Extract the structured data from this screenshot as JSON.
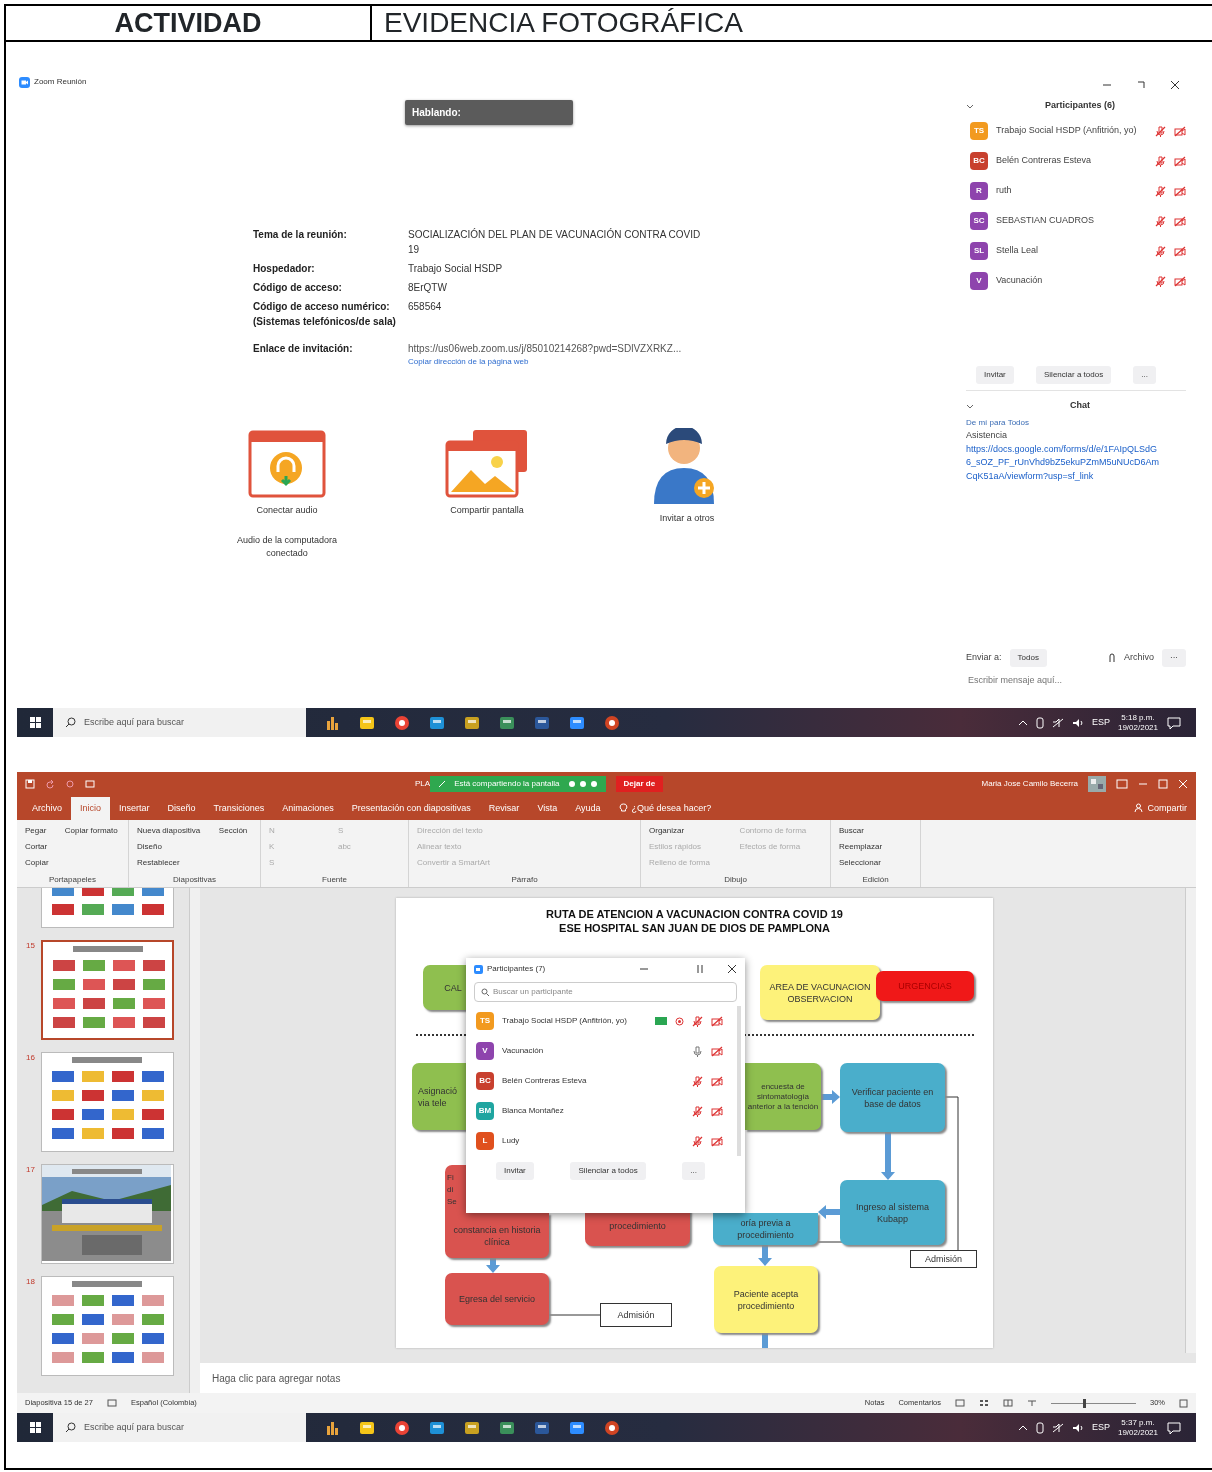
{
  "header": {
    "activity": "ACTIVIDAD",
    "evidence": "EVIDENCIA FOTOGRÁFICA"
  },
  "zoom": {
    "title": "Zoom Reunión",
    "speaking": "Hablando:",
    "info": [
      {
        "label": "Tema de la reunión:",
        "value": "SOCIALIZACIÓN DEL PLAN DE VACUNACIÓN CONTRA COVID 19"
      },
      {
        "label": "Hospedador:",
        "value": "Trabajo Social HSDP"
      },
      {
        "label": "Código de acceso:",
        "value": "8ErQTW"
      },
      {
        "label": "Código de acceso numérico: (Sistemas telefónicos/de sala)",
        "value": "658564"
      }
    ],
    "invite": {
      "label": "Enlace de invitación:",
      "url": "https://us06web.zoom.us/j/85010214268?pwd=SDlVZXRKZ...",
      "copy": "Copiar dirección de la página web"
    },
    "actions": [
      {
        "kind": "audio",
        "label": "Conectar audio",
        "note": "Audio de la computadora conectado"
      },
      {
        "kind": "share",
        "label": "Compartir pantalla"
      },
      {
        "kind": "invite",
        "label": "Invitar a otros"
      }
    ],
    "participants_title": "Participantes (6)",
    "participants": [
      {
        "initials": "TS",
        "name": "Trabajo Social HSDP (Anfitrión, yo)",
        "color": "#f29a1f",
        "mic_muted": true
      },
      {
        "initials": "BC",
        "name": "Belén Contreras Esteva",
        "color": "#c8402e",
        "mic_muted": true
      },
      {
        "initials": "R",
        "name": "ruth",
        "color": "#8e44ad",
        "mic_muted": true
      },
      {
        "initials": "SC",
        "name": "SEBASTIAN CUADROS",
        "color": "#8e44ad",
        "mic_muted": true
      },
      {
        "initials": "SL",
        "name": "Stella Leal",
        "color": "#8e44ad",
        "mic_muted": true
      },
      {
        "initials": "V",
        "name": "Vacunación",
        "color": "#8e44ad",
        "mic_muted": true
      }
    ],
    "buttons": [
      "Invitar",
      "Silenciar a todos",
      "..."
    ],
    "chat": {
      "title": "Chat",
      "from": "De mí para Todos",
      "message": "Asistencia",
      "link": "https://docs.google.com/forms/d/e/1FAIpQLSdG6_sOZ_PF_rUnVhd9bZ5ekuPZmM5uNUcD6AmCqK51aA/viewform?usp=sf_link"
    },
    "send_to_label": "Enviar a:",
    "send_to": "Todos",
    "file": "Archivo",
    "more": "···",
    "input_placeholder": "Escribir mensaje aquí...",
    "taskbar": {
      "search_placeholder": "Escribe aquí para buscar",
      "lang": "ESP",
      "time": "5:18 p.m.",
      "date": "19/02/2021"
    }
  },
  "powerpoint": {
    "file_title": "PLA",
    "share_text": "Está compartiendo la pantalla",
    "stop": "Dejar de",
    "user": "Maria Jose Camilo Becerra",
    "tabs": [
      {
        "label": "Archivo",
        "selected": false
      },
      {
        "label": "Inicio",
        "selected": true
      },
      {
        "label": "Insertar",
        "selected": false
      },
      {
        "label": "Diseño",
        "selected": false
      },
      {
        "label": "Transiciones",
        "selected": false
      },
      {
        "label": "Animaciones",
        "selected": false
      },
      {
        "label": "Presentación con diapositivas",
        "selected": false
      },
      {
        "label": "Revisar",
        "selected": false
      },
      {
        "label": "Vista",
        "selected": false
      },
      {
        "label": "Ayuda",
        "selected": false
      }
    ],
    "tell_me": "¿Qué desea hacer?",
    "share": "Compartir",
    "ribbon": [
      {
        "group": "Portapapeles",
        "items": [
          {
            "label": "Pegar",
            "disabled": false
          },
          {
            "label": "Cortar",
            "disabled": false
          },
          {
            "label": "Copiar",
            "disabled": false
          },
          {
            "label": "Copiar formato",
            "disabled": false
          }
        ]
      },
      {
        "group": "Diapositivas",
        "items": [
          {
            "label": "Nueva diapositiva",
            "disabled": false
          },
          {
            "label": "Diseño",
            "disabled": false
          },
          {
            "label": "Restablecer",
            "disabled": false
          },
          {
            "label": "Sección",
            "disabled": false
          }
        ]
      },
      {
        "group": "Fuente",
        "items": [
          {
            "label": "N",
            "disabled": true
          },
          {
            "label": "K",
            "disabled": true
          },
          {
            "label": "S",
            "disabled": true
          },
          {
            "label": "S",
            "disabled": true
          },
          {
            "label": "abc",
            "disabled": true
          }
        ]
      },
      {
        "group": "Párrafo",
        "items": [
          {
            "label": "Dirección del texto",
            "disabled": true
          },
          {
            "label": "Alinear texto",
            "disabled": true
          },
          {
            "label": "Convertir a SmartArt",
            "disabled": true
          }
        ]
      },
      {
        "group": "Dibujo",
        "items": [
          {
            "label": "Organizar",
            "disabled": false
          },
          {
            "label": "Estilos rápidos",
            "disabled": true
          },
          {
            "label": "Relleno de forma",
            "disabled": true
          },
          {
            "label": "Contorno de forma",
            "disabled": true
          },
          {
            "label": "Efectos de forma",
            "disabled": true
          }
        ]
      },
      {
        "group": "Edición",
        "items": [
          {
            "label": "Buscar",
            "disabled": false
          },
          {
            "label": "Reemplazar",
            "disabled": false
          },
          {
            "label": "Seleccionar",
            "disabled": false
          }
        ]
      }
    ],
    "thumbnails": [
      {
        "kind": "diagram",
        "selected": false
      },
      {
        "number": "15",
        "kind": "diagram",
        "selected": true
      },
      {
        "number": "16",
        "kind": "diagram",
        "selected": false
      },
      {
        "number": "17",
        "kind": "picture",
        "selected": false
      },
      {
        "number": "18",
        "kind": "diagram",
        "selected": false
      }
    ],
    "slide_title": [
      "RUTA DE ATENCION A VACUNACION CONTRA COVID 19",
      "ESE HOSPITAL SAN JUAN DE DIOS DE PAMPLONA"
    ],
    "boxes": [
      {
        "text": "CAL",
        "color": "#8fbf4f"
      },
      {
        "text": "AREA DE VACUNACION OBSERVACION",
        "color": "#fdf27a"
      },
      {
        "text": "URGENCIAS",
        "color": "#f01818"
      },
      {
        "text": "Asignació via tele",
        "color": "#8fbf4f"
      },
      {
        "text": "encuesta de sintomatología anterior a la tención",
        "color": "#8fbf4f"
      },
      {
        "text": "Verificar paciente en base de datos",
        "color": "#4aaecb"
      },
      {
        "text": "Fi di Se",
        "color": "#d9534f"
      },
      {
        "text": "constancia en historia clínica",
        "color": "#d9534f"
      },
      {
        "text": "procedimiento",
        "color": "#d9534f"
      },
      {
        "text": "oría previa a procedimiento",
        "color": "#4aaecb"
      },
      {
        "text": "Ingreso al sistema Kubapp",
        "color": "#4aaecb"
      },
      {
        "text": "Admisión",
        "color": "#ffffff"
      },
      {
        "text": "Egresa del servicio",
        "color": "#d9534f"
      },
      {
        "text": "Admisión",
        "color": "#ffffff"
      },
      {
        "text": "Paciente acepta procedimiento",
        "color": "#fdf27a"
      }
    ],
    "popup": {
      "title": "Participantes (7)",
      "search_placeholder": "Buscar un participante",
      "items": [
        {
          "initials": "TS",
          "name": "Trabajo Social HSDP (Anfitrión, yo)",
          "color": "#f29a1f",
          "mic_muted": true
        },
        {
          "initials": "V",
          "name": "Vacunación",
          "color": "#8e44ad",
          "mic_muted": false
        },
        {
          "initials": "BC",
          "name": "Belén Contreras Esteva",
          "color": "#c8402e",
          "mic_muted": true
        },
        {
          "initials": "BM",
          "name": "Blanca Montañez",
          "color": "#1fa5a0",
          "mic_muted": true
        },
        {
          "initials": "L",
          "name": "Ludy",
          "color": "#e0501e",
          "mic_muted": true
        }
      ],
      "buttons": [
        "Invitar",
        "Silenciar a todos",
        "..."
      ]
    },
    "notes_placeholder": "Haga clic para agregar notas",
    "status": {
      "slide": "Diapositiva 15 de 27",
      "language": "Español (Colombia)",
      "notes": "Notas",
      "comments": "Comentarios",
      "zoom": "30%",
      "level": 0.38
    },
    "taskbar": {
      "search_placeholder": "Escribe aquí para buscar",
      "lang": "ESP",
      "time": "5:37 p.m.",
      "date": "19/02/2021"
    }
  }
}
